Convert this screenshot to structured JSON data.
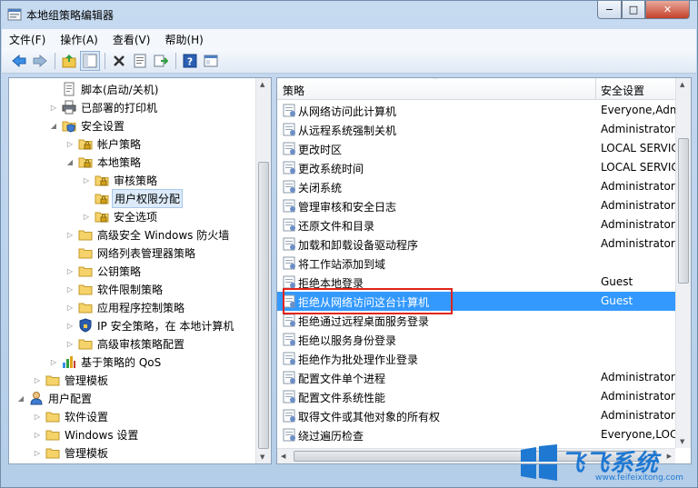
{
  "window": {
    "title": "本地组策略编辑器",
    "caption_min": "−",
    "caption_max": "□",
    "caption_close": "✕"
  },
  "menu": [
    "文件(F)",
    "操作(A)",
    "查看(V)",
    "帮助(H)"
  ],
  "toolbar": [
    "back-arrow-icon",
    "forward-arrow-icon",
    "up-folder-icon",
    "show-tree-icon",
    "delete-icon",
    "properties-icon",
    "export-icon",
    "help-icon",
    "extended-view-icon"
  ],
  "tree": [
    {
      "label": "脚本(启动/关机)",
      "indent": 3,
      "expander": "",
      "icon": "script"
    },
    {
      "label": "已部署的打印机",
      "indent": 3,
      "expander": "▷",
      "icon": "printer"
    },
    {
      "label": "安全设置",
      "indent": 3,
      "expander": "◢",
      "icon": "security"
    },
    {
      "label": "帐户策略",
      "indent": 4,
      "expander": "▷",
      "icon": "folder-lock"
    },
    {
      "label": "本地策略",
      "indent": 4,
      "expander": "◢",
      "icon": "folder-lock"
    },
    {
      "label": "审核策略",
      "indent": 5,
      "expander": "▷",
      "icon": "folder-lock"
    },
    {
      "label": "用户权限分配",
      "indent": 5,
      "expander": "",
      "icon": "folder-lock",
      "selected": true
    },
    {
      "label": "安全选项",
      "indent": 5,
      "expander": "▷",
      "icon": "folder-lock"
    },
    {
      "label": "高级安全 Windows 防火墙",
      "indent": 4,
      "expander": "▷",
      "icon": "folder"
    },
    {
      "label": "网络列表管理器策略",
      "indent": 4,
      "expander": "",
      "icon": "folder"
    },
    {
      "label": "公钥策略",
      "indent": 4,
      "expander": "▷",
      "icon": "folder"
    },
    {
      "label": "软件限制策略",
      "indent": 4,
      "expander": "▷",
      "icon": "folder"
    },
    {
      "label": "应用程序控制策略",
      "indent": 4,
      "expander": "▷",
      "icon": "folder"
    },
    {
      "label": "IP 安全策略，在 本地计算机",
      "indent": 4,
      "expander": "▷",
      "icon": "ipsec"
    },
    {
      "label": "高级审核策略配置",
      "indent": 4,
      "expander": "▷",
      "icon": "folder"
    },
    {
      "label": "基于策略的 QoS",
      "indent": 3,
      "expander": "▷",
      "icon": "chart"
    },
    {
      "label": "管理模板",
      "indent": 2,
      "expander": "▷",
      "icon": "folder"
    },
    {
      "label": "用户配置",
      "indent": 1,
      "expander": "◢",
      "icon": "user"
    },
    {
      "label": "软件设置",
      "indent": 2,
      "expander": "▷",
      "icon": "folder"
    },
    {
      "label": "Windows 设置",
      "indent": 2,
      "expander": "▷",
      "icon": "folder"
    },
    {
      "label": "管理模板",
      "indent": 2,
      "expander": "▷",
      "icon": "folder"
    }
  ],
  "list": {
    "header_policy": "策略",
    "header_setting": "安全设置",
    "sort_indicator": "⌃",
    "rows": [
      {
        "name": "从网络访问此计算机",
        "value": "Everyone,Adm"
      },
      {
        "name": "从远程系统强制关机",
        "value": "Administrators"
      },
      {
        "name": "更改时区",
        "value": "LOCAL SERVICE"
      },
      {
        "name": "更改系统时间",
        "value": "LOCAL SERVICE"
      },
      {
        "name": "关闭系统",
        "value": "Administrators"
      },
      {
        "name": "管理审核和安全日志",
        "value": "Administrators"
      },
      {
        "name": "还原文件和目录",
        "value": "Administrators"
      },
      {
        "name": "加载和卸载设备驱动程序",
        "value": "Administrators"
      },
      {
        "name": "将工作站添加到域",
        "value": ""
      },
      {
        "name": "拒绝本地登录",
        "value": "Guest"
      },
      {
        "name": "拒绝从网络访问这台计算机",
        "value": "Guest",
        "selected": true
      },
      {
        "name": "拒绝通过远程桌面服务登录",
        "value": ""
      },
      {
        "name": "拒绝以服务身份登录",
        "value": ""
      },
      {
        "name": "拒绝作为批处理作业登录",
        "value": ""
      },
      {
        "name": "配置文件单个进程",
        "value": "Administrators"
      },
      {
        "name": "配置文件系统性能",
        "value": "Administrators"
      },
      {
        "name": "取得文件或其他对象的所有权",
        "value": "Administrators"
      },
      {
        "name": "绕过遍历检查",
        "value": "Everyone,LOC"
      }
    ]
  },
  "watermark": {
    "text": "飞飞系统",
    "url": "www.feifeixitong.com"
  },
  "colors": {
    "selection": "#3399ff",
    "highlight_box": "#e2231a",
    "watermark": "#1f78d1"
  }
}
